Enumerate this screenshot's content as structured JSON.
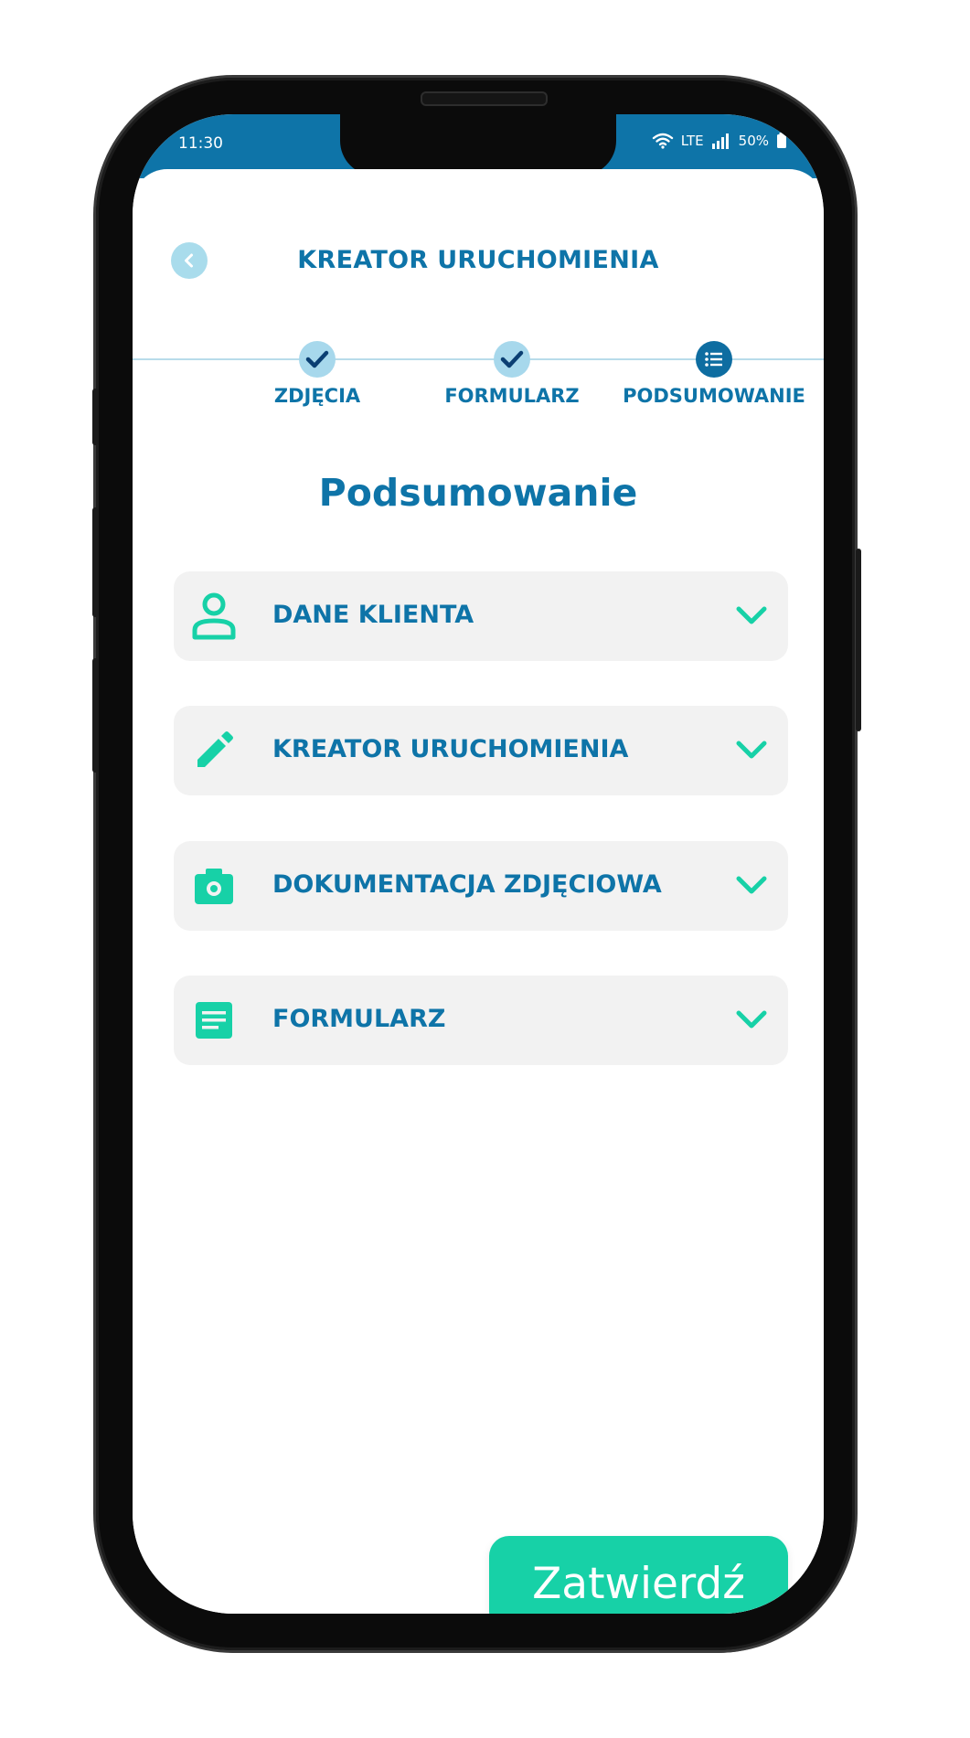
{
  "status_bar": {
    "time": "11:30",
    "network": "LTE",
    "battery": "50%"
  },
  "header": {
    "title": "KREATOR URUCHOMIENIA",
    "back_icon": "chevron-left-icon"
  },
  "stepper": {
    "steps": [
      {
        "label": "ZDJĘCIA",
        "state": "done",
        "icon": "check-icon"
      },
      {
        "label": "FORMULARZ",
        "state": "done",
        "icon": "check-icon"
      },
      {
        "label": "PODSUMOWANIE",
        "state": "current",
        "icon": "list-icon"
      }
    ]
  },
  "page": {
    "title": "Podsumowanie"
  },
  "sections": [
    {
      "label": "DANE KLIENTA",
      "icon": "person-icon"
    },
    {
      "label": "KREATOR URUCHOMIENIA",
      "icon": "pencil-icon"
    },
    {
      "label": "DOKUMENTACJA ZDJĘCIOWA",
      "icon": "camera-icon"
    },
    {
      "label": "FORMULARZ",
      "icon": "document-icon"
    }
  ],
  "actions": {
    "confirm_label": "Zatwierdź"
  },
  "colors": {
    "primary": "#0e74a8",
    "accent": "#17d1a7",
    "status_bar": "#0e74a8",
    "card_bg": "#f2f2f2"
  }
}
